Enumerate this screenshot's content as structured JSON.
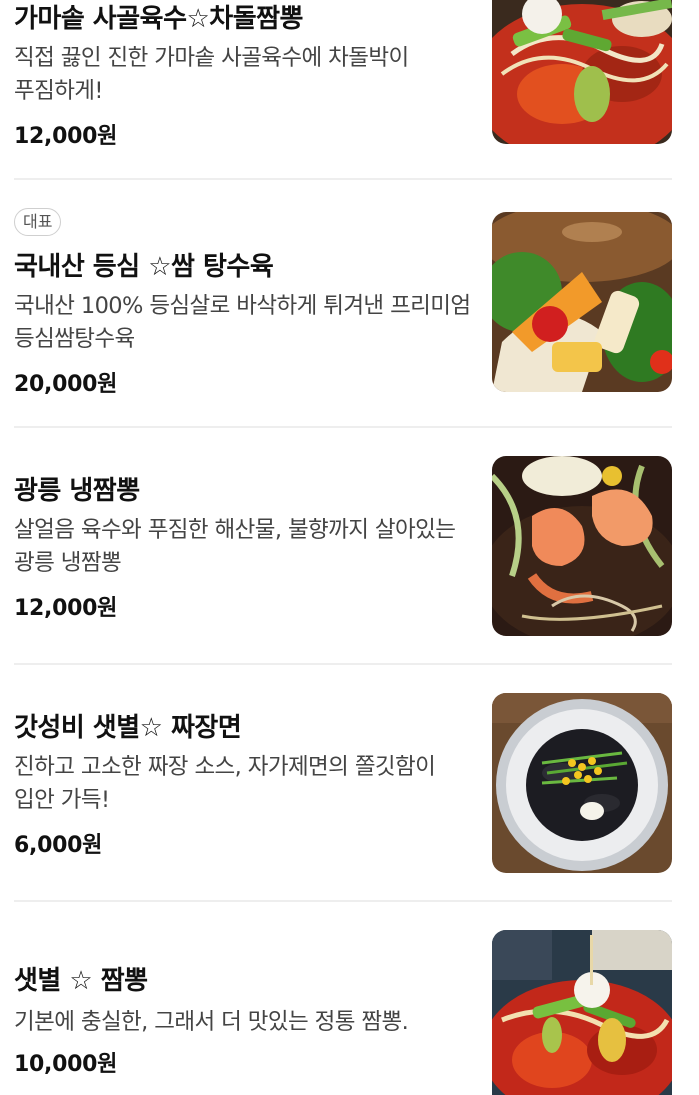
{
  "menu": {
    "items": [
      {
        "badge": "",
        "title": "가마솥 사골육수☆차돌짬뽕",
        "description": "직접 끓인 진한 가마솥 사골육수에 차돌박이 푸짐하게!",
        "price": "12,000원",
        "image": "jjamppong-brisket-photo"
      },
      {
        "badge": "대표",
        "title": "국내산 등심 ☆쌈 탕수육",
        "description": "국내산 100% 등심살로 바삭하게 튀겨낸 프리미엄 등심쌈탕수육",
        "price": "20,000원",
        "image": "tangsuyuk-wrap-photo"
      },
      {
        "badge": "",
        "title": "광릉 냉짬뽕",
        "description": "살얼음 육수와 푸짐한 해산물, 불향까지 살아있는 광릉 냉짬뽕",
        "price": "12,000원",
        "image": "cold-jjamppong-photo"
      },
      {
        "badge": "",
        "title": "갓성비 샛별☆ 짜장면",
        "description": "진하고 고소한 짜장 소스, 자가제면의 쫄깃함이 입안 가득!",
        "price": "6,000원",
        "image": "jjajangmyeon-photo"
      },
      {
        "badge": "",
        "title": "샛별 ☆ 짬뽕",
        "description": "기본에 충실한, 그래서 더 맛있는 정통 짬뽕.",
        "price": "10,000원",
        "image": "jjamppong-photo"
      }
    ]
  },
  "colors": {
    "title": "#111111",
    "description": "#444444",
    "divider": "#eeeeee",
    "badge_border": "#cfcfcf"
  }
}
